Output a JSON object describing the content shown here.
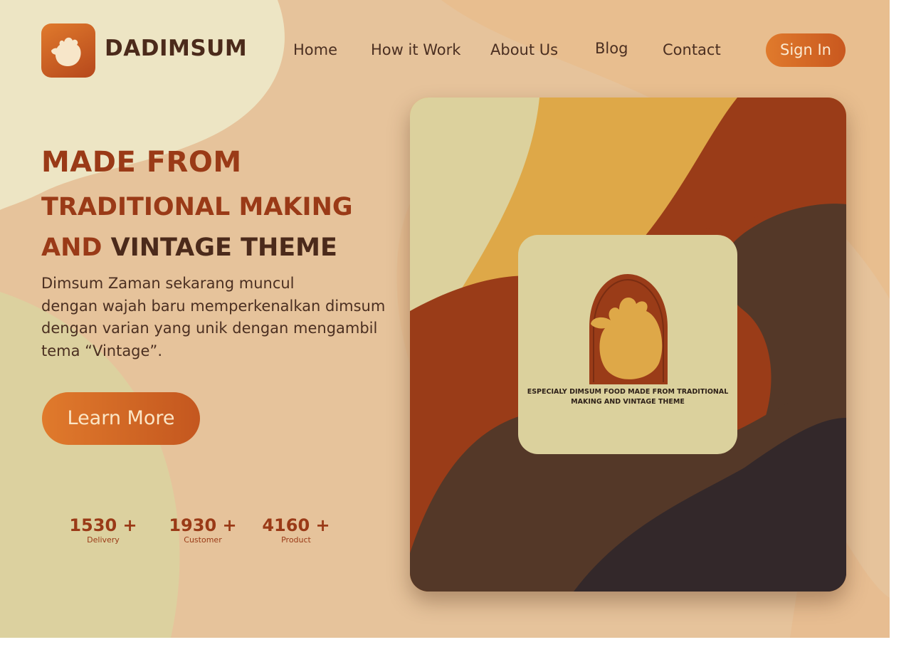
{
  "brand": {
    "name": "DADIMSUM",
    "logo_icon": "dumpling-icon"
  },
  "nav": {
    "items": [
      {
        "label": "Home"
      },
      {
        "label": "How it Work"
      },
      {
        "label": "About Us"
      },
      {
        "label": "Blog"
      },
      {
        "label": "Contact"
      }
    ],
    "signin_label": "Sign In"
  },
  "hero": {
    "headline_line1": "MADE FROM",
    "headline_line2": "TRADITIONAL MAKING",
    "headline_line3_a": "AND",
    "headline_line3_b": "VINTAGE THEME",
    "description_lines": [
      "Dimsum Zaman sekarang muncul",
      "dengan wajah baru memperkenalkan dimsum",
      "dengan varian yang unik dengan mengambil",
      "tema “Vintage”."
    ],
    "cta_label": "Learn More"
  },
  "stats": [
    {
      "value": "1530 +",
      "label": "Delivery"
    },
    {
      "value": "1930 +",
      "label": "Customer"
    },
    {
      "value": "4160 +",
      "label": "Product"
    }
  ],
  "showcase": {
    "tagline_line1": "ESPECIALY DIMSUM FOOD MADE FROM TRADITIONAL",
    "tagline_line2": "MAKING AND VINTAGE THEME",
    "emblem_icon": "dumpling-icon"
  },
  "colors": {
    "accent_orange": "#e07a2c",
    "rust": "#9a3a17",
    "dark_brown": "#4b2a1b",
    "cream": "#dbd19d",
    "mustard": "#dea848",
    "background": "#e6c39b"
  }
}
